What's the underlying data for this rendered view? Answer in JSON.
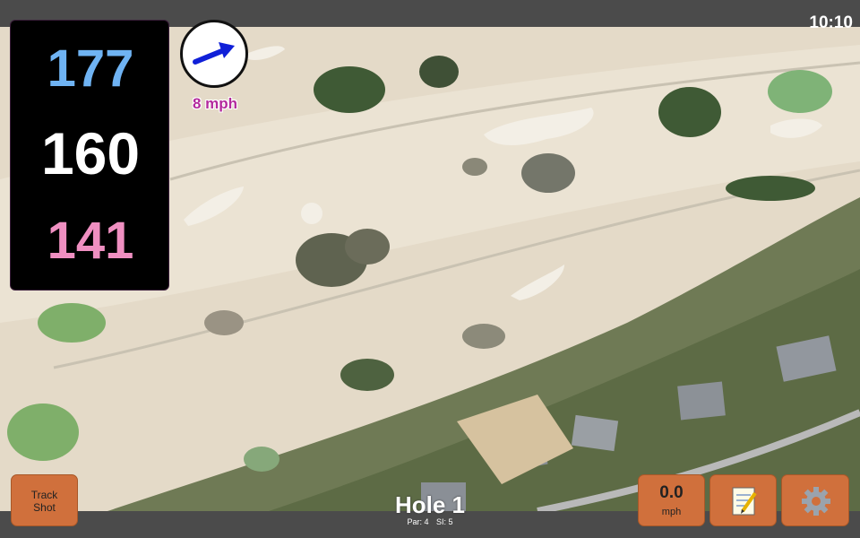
{
  "status": {
    "time": "10:10"
  },
  "yardage": {
    "back": "177",
    "middle": "160",
    "front": "141"
  },
  "wind": {
    "speed_label": "8 mph",
    "arrow_icon": "arrow-right-icon"
  },
  "hole": {
    "title": "Hole 1",
    "par": "Par: 4",
    "si": "SI: 5"
  },
  "buttons": {
    "track_shot_line1": "Track",
    "track_shot_line2": "Shot",
    "speed_value": "0.0",
    "speed_unit": "mph",
    "notes_icon": "notepad-icon",
    "settings_icon": "gear-icon"
  },
  "colors": {
    "accent_orange": "#d0703c",
    "back_yardage": "#6fb3f3",
    "front_yardage": "#ef8fc1",
    "wind_label": "#b3299d"
  }
}
